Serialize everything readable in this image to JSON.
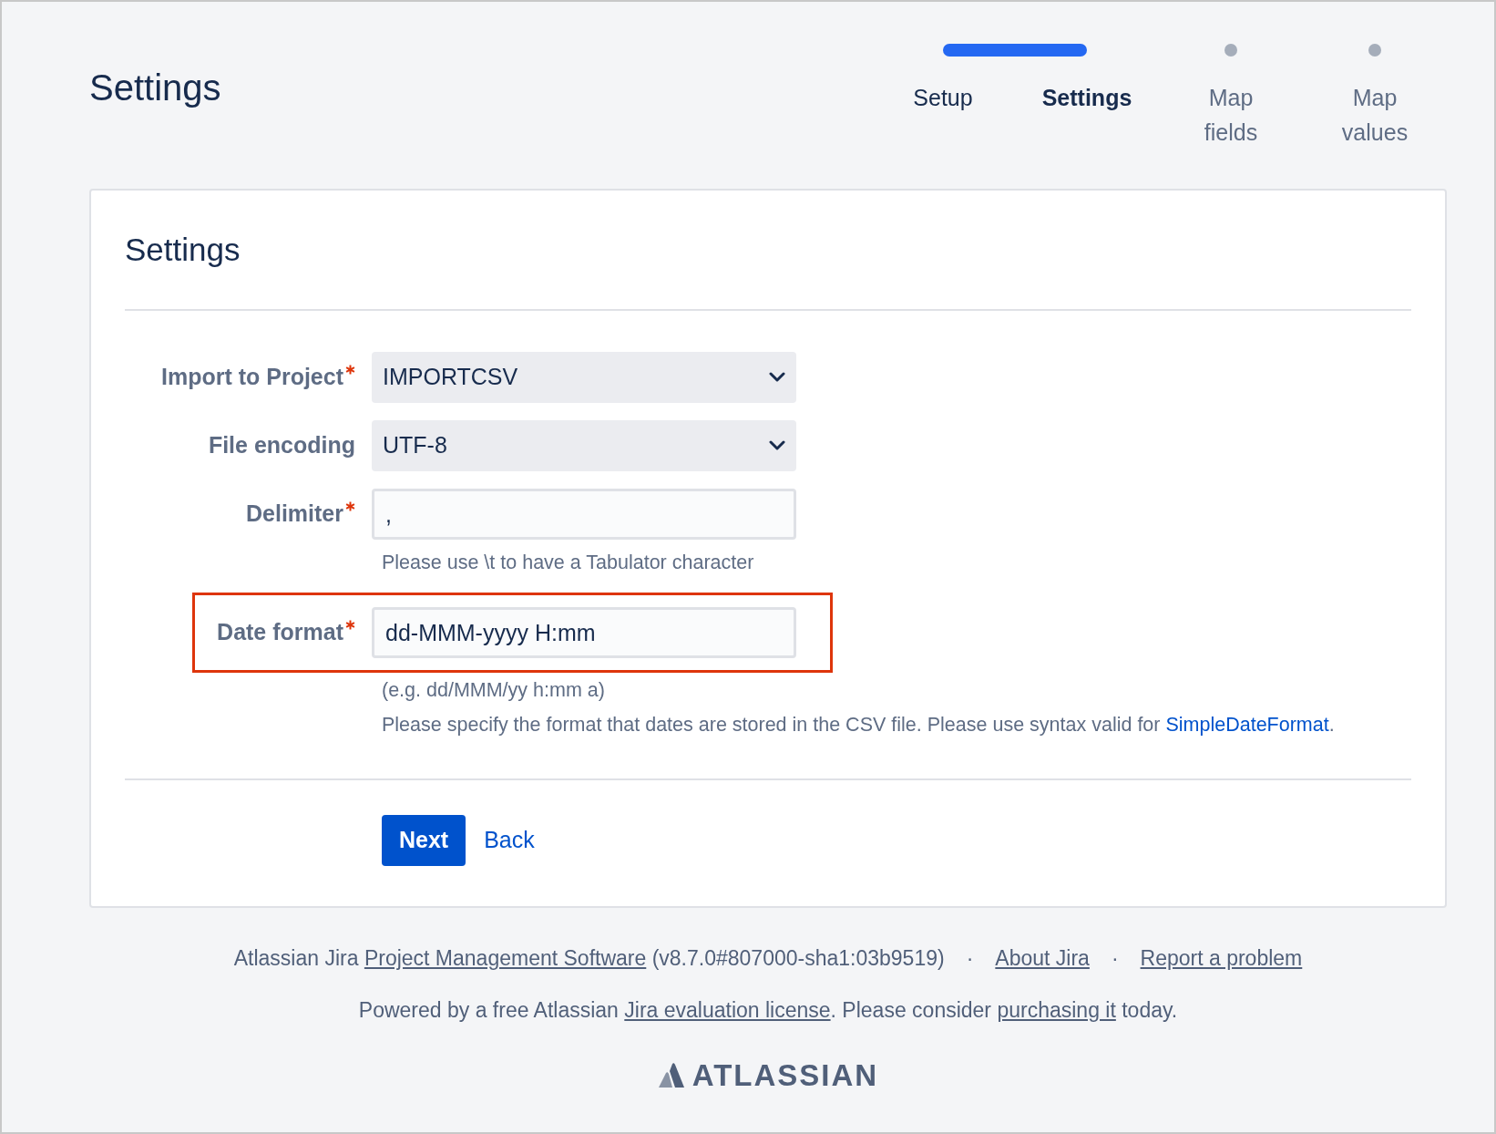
{
  "page_title": "Settings",
  "steps": [
    {
      "label": "Setup",
      "reached": true,
      "selected": false
    },
    {
      "label": "Settings",
      "reached": true,
      "selected": true
    },
    {
      "label": "Map fields",
      "reached": false,
      "selected": false
    },
    {
      "label": "Map values",
      "reached": false,
      "selected": false
    }
  ],
  "card": {
    "title": "Settings",
    "fields": [
      {
        "kind": "select",
        "label": "Import to Project",
        "required": true,
        "value": "IMPORTCSV",
        "highlighted": false
      },
      {
        "kind": "select",
        "label": "File encoding",
        "required": false,
        "value": "UTF-8",
        "highlighted": false
      },
      {
        "kind": "text",
        "label": "Delimiter",
        "required": true,
        "value": ",",
        "highlighted": false,
        "help": [
          [
            {
              "kind": "text",
              "text": "Please use \\t to have a Tabulator character"
            }
          ]
        ]
      },
      {
        "kind": "text",
        "label": "Date format",
        "required": true,
        "value": "dd-MMM-yyyy H:mm",
        "highlighted": true,
        "help": [
          [
            {
              "kind": "text",
              "text": "(e.g. dd/MMM/yy h:mm a)"
            }
          ],
          [
            {
              "kind": "text",
              "text": "Please specify the format that dates are stored in the CSV file. Please use syntax valid for "
            },
            {
              "kind": "link",
              "text": "SimpleDateFormat"
            },
            {
              "kind": "text",
              "text": "."
            }
          ]
        ]
      }
    ],
    "buttons": [
      {
        "kind": "primary",
        "label": "Next"
      },
      {
        "kind": "link",
        "label": "Back"
      }
    ]
  },
  "footer": {
    "lines": [
      [
        {
          "kind": "text",
          "text": "Atlassian Jira "
        },
        {
          "kind": "link",
          "text": "Project Management Software"
        },
        {
          "kind": "text",
          "text": " (v8.7.0#807000-sha1:03b9519)"
        },
        {
          "kind": "separator",
          "text": "·"
        },
        {
          "kind": "link",
          "text": "About Jira"
        },
        {
          "kind": "separator",
          "text": "·"
        },
        {
          "kind": "link",
          "text": "Report a problem"
        }
      ],
      [
        {
          "kind": "text",
          "text": "Powered by a free Atlassian "
        },
        {
          "kind": "link",
          "text": "Jira evaluation license"
        },
        {
          "kind": "text",
          "text": ". Please consider "
        },
        {
          "kind": "link",
          "text": "purchasing it"
        },
        {
          "kind": "text",
          "text": " today."
        }
      ]
    ],
    "logo_text": "ATLASSIAN"
  }
}
